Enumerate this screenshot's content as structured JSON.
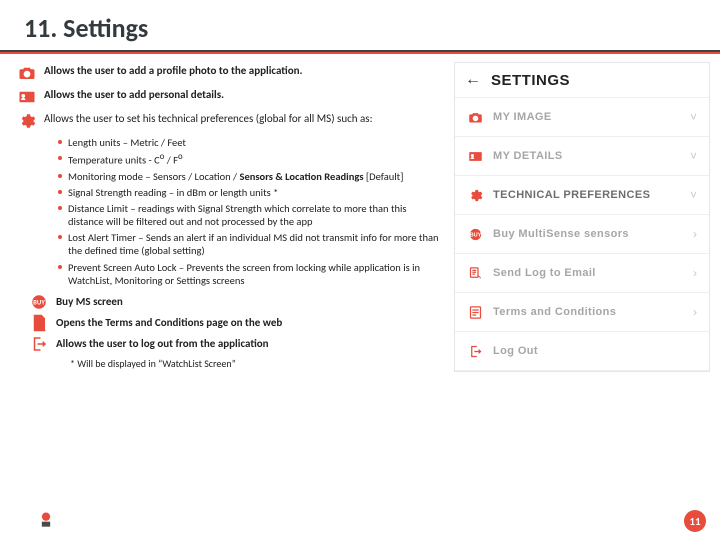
{
  "title": "11. Settings",
  "left": {
    "camera": "Allows the user to add a profile photo to the application.",
    "card": "Allows the user to add personal details.",
    "gear": "Allows the user to set his technical preferences (global for all MS) such as:",
    "sub": [
      {
        "a": "Length units – Metric / Feet"
      },
      {
        "a": "Temperature units - C",
        "b": "o",
        "c": " / F",
        "d": "o"
      },
      {
        "a": "Monitoring mode – Sensors / Location / ",
        "b": "Sensors & Location Readings",
        "c": " [Default]"
      },
      {
        "a": "Signal Strength reading – in dBm or length units *"
      },
      {
        "a": "Distance Limit – readings with Signal Strength which correlate to more than this distance will be filtered out and not processed by the app"
      },
      {
        "a": "Lost Alert Timer – Sends an alert if an individual MS did not transmit info for more than the defined time (global setting)"
      },
      {
        "a": "Prevent Screen Auto Lock – Prevents the screen from locking while application is in WatchList, Monitoring or Settings screens"
      }
    ],
    "buy": "Buy MS screen",
    "tc": "Opens the Terms and Conditions page on the web",
    "logout": "Allows the user to log out from the application",
    "note": "* Will be displayed in “WatchList Screen”"
  },
  "phone": {
    "title": "SETTINGS",
    "rows": [
      {
        "k": "camera",
        "label": "MY IMAGE",
        "open": "v"
      },
      {
        "k": "card",
        "label": "MY DETAILS",
        "open": "v"
      },
      {
        "k": "gear",
        "label": "TECHNICAL PREFERENCES",
        "open": "v",
        "sel": true
      },
      {
        "k": "buy",
        "label": "Buy MultiSense sensors",
        "open": ">"
      },
      {
        "k": "log",
        "label": "Send Log to Email",
        "open": ">"
      },
      {
        "k": "tc",
        "label": "Terms and Conditions",
        "open": ">"
      },
      {
        "k": "out",
        "label": "Log Out",
        "open": ""
      }
    ]
  },
  "page": "11"
}
